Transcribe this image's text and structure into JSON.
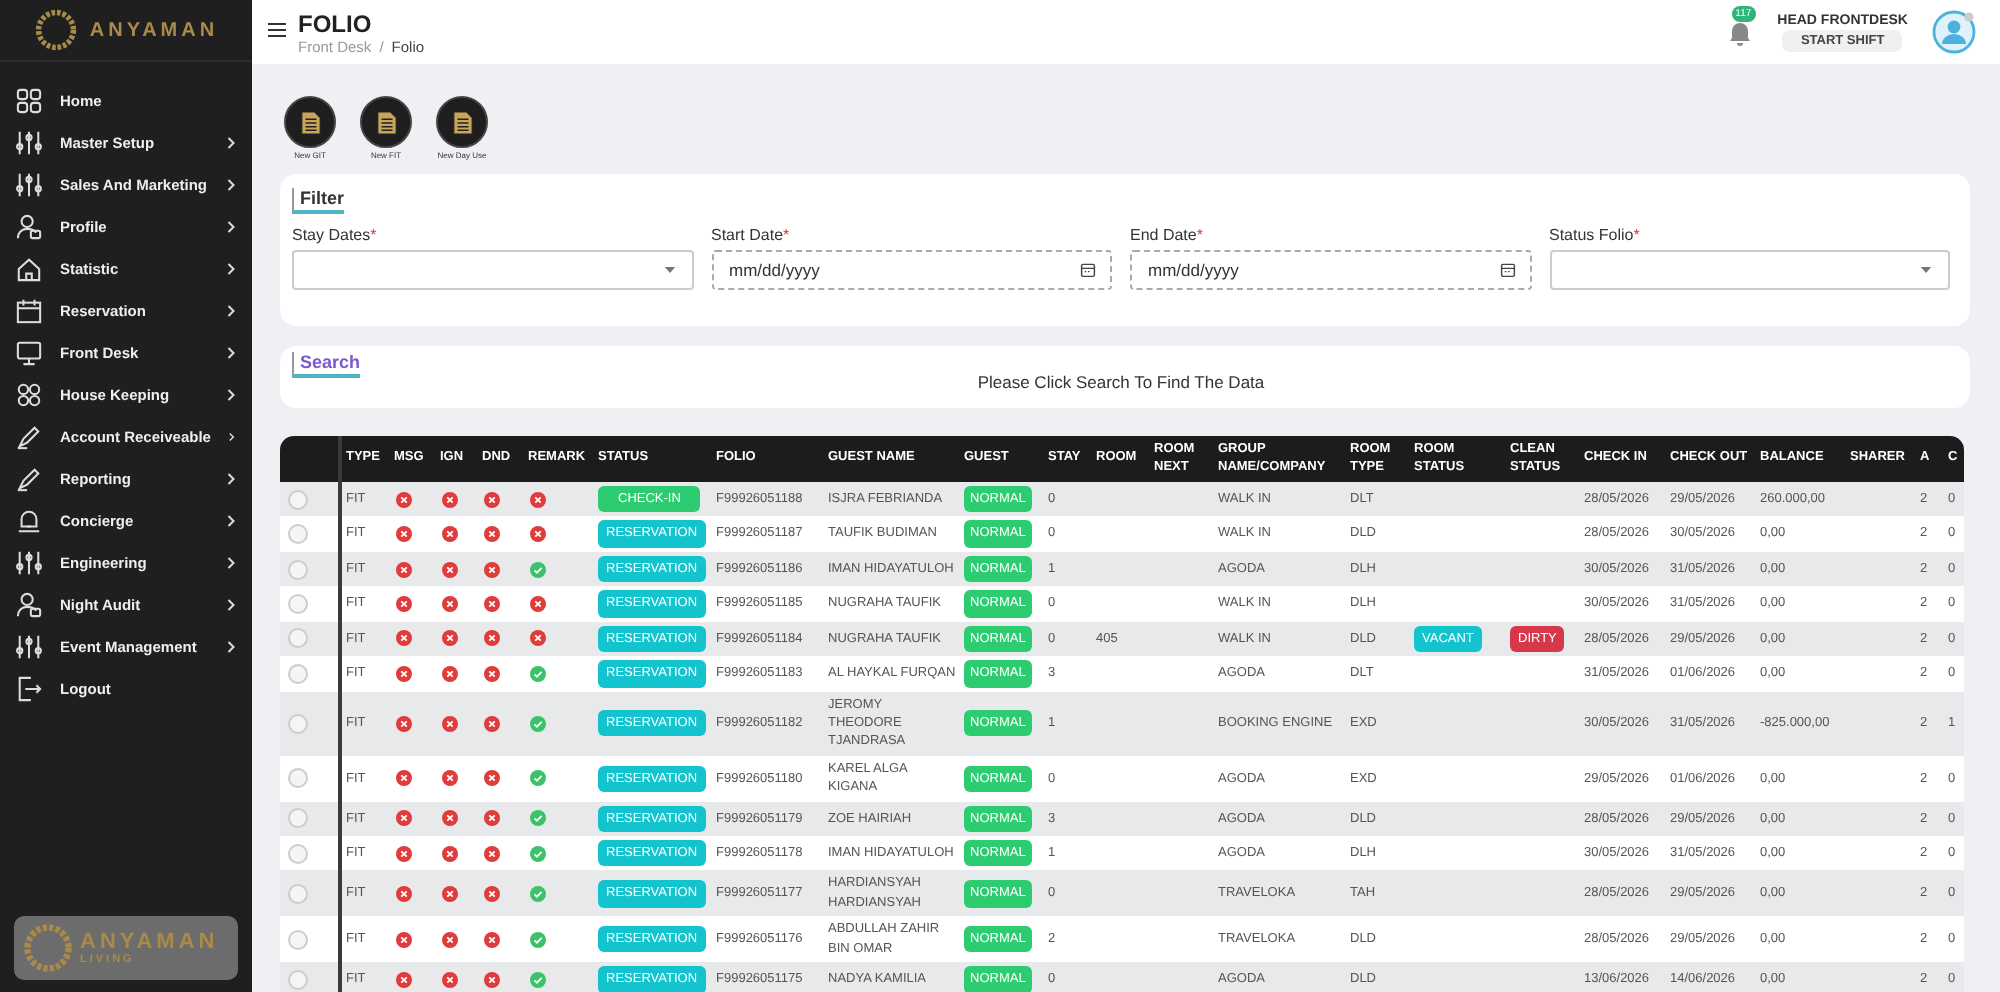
{
  "sidebar": {
    "brand": "ANYAMAN",
    "items": [
      {
        "label": "Home",
        "submenu": false
      },
      {
        "label": "Master Setup",
        "submenu": true
      },
      {
        "label": "Sales And Marketing",
        "submenu": true
      },
      {
        "label": "Profile",
        "submenu": true
      },
      {
        "label": "Statistic",
        "submenu": true
      },
      {
        "label": "Reservation",
        "submenu": true
      },
      {
        "label": "Front Desk",
        "submenu": true
      },
      {
        "label": "House Keeping",
        "submenu": true
      },
      {
        "label": "Account Receiveable",
        "submenu": true
      },
      {
        "label": "Reporting",
        "submenu": true
      },
      {
        "label": "Concierge",
        "submenu": true
      },
      {
        "label": "Engineering",
        "submenu": true
      },
      {
        "label": "Night Audit",
        "submenu": true
      },
      {
        "label": "Event Management",
        "submenu": true
      },
      {
        "label": "Logout",
        "submenu": false
      }
    ],
    "footer_brand": "ANYAMAN",
    "footer_sub": "LIVING"
  },
  "header": {
    "title": "FOLIO",
    "breadcrumb": [
      "Front Desk",
      "Folio"
    ],
    "breadcrumb_sep": "/",
    "notifications": "117",
    "user": "HEAD FRONTDESK",
    "shift_button": "START SHIFT"
  },
  "quick_actions": [
    "New GIT",
    "New FIT",
    "New Day Use"
  ],
  "filter": {
    "title": "Filter",
    "fields": [
      {
        "label": "Stay Dates",
        "required_mark": "*",
        "kind": "select"
      },
      {
        "label": "Start Date",
        "required_mark": "*",
        "kind": "date",
        "placeholder": "mm/dd/yyyy"
      },
      {
        "label": "End Date",
        "required_mark": "*",
        "kind": "date",
        "placeholder": "mm/dd/yyyy"
      },
      {
        "label": "Status Folio",
        "required_mark": "*",
        "kind": "select"
      }
    ]
  },
  "search": {
    "title": "Search",
    "message": "Please Click Search To Find The Data"
  },
  "table": {
    "columns": [
      "TYPE",
      "MSG",
      "IGN",
      "DND",
      "REMARK",
      "STATUS",
      "FOLIO",
      "GUEST NAME",
      "GUEST",
      "STAY",
      "ROOM",
      "ROOM NEXT",
      "GROUP NAME/COMPANY",
      "ROOM TYPE",
      "ROOM STATUS",
      "CLEAN STATUS",
      "CHECK IN",
      "CHECK OUT",
      "BALANCE",
      "SHARER",
      "A",
      "C"
    ],
    "rows": [
      {
        "checked": false,
        "type": "FIT",
        "msg": false,
        "ign": false,
        "dnd": false,
        "remark": false,
        "status": {
          "label": "CHECK-IN",
          "kind": "checkin"
        },
        "folio": "F99926051188",
        "guest_name": "ISJRA FEBRIANDA",
        "guest": "NORMAL",
        "stay": "0",
        "group": "WALK IN",
        "room_type": "DLT",
        "check_in": "28/05/2026",
        "check_out": "29/05/2026",
        "balance": "260.000,00",
        "a": "2",
        "c": "0"
      },
      {
        "checked": false,
        "type": "FIT",
        "msg": false,
        "ign": false,
        "dnd": false,
        "remark": false,
        "status": {
          "label": "RESERVATION",
          "kind": "reservation"
        },
        "folio": "F99926051187",
        "guest_name": "TAUFIK BUDIMAN",
        "guest": "NORMAL",
        "stay": "0",
        "group": "WALK IN",
        "room_type": "DLD",
        "check_in": "28/05/2026",
        "check_out": "30/05/2026",
        "balance": "0,00",
        "a": "2",
        "c": "0"
      },
      {
        "checked": false,
        "type": "FIT",
        "msg": false,
        "ign": false,
        "dnd": false,
        "remark": true,
        "status": {
          "label": "RESERVATION",
          "kind": "reservation"
        },
        "folio": "F99926051186",
        "guest_name": "IMAN HIDAYATULOH",
        "guest": "NORMAL",
        "stay": "1",
        "group": "AGODA",
        "room_type": "DLH",
        "check_in": "30/05/2026",
        "check_out": "31/05/2026",
        "balance": "0,00",
        "a": "2",
        "c": "0"
      },
      {
        "checked": false,
        "type": "FIT",
        "msg": false,
        "ign": false,
        "dnd": false,
        "remark": false,
        "status": {
          "label": "RESERVATION",
          "kind": "reservation"
        },
        "folio": "F99926051185",
        "guest_name": "NUGRAHA TAUFIK",
        "guest": "NORMAL",
        "stay": "0",
        "group": "WALK IN",
        "room_type": "DLH",
        "check_in": "30/05/2026",
        "check_out": "31/05/2026",
        "balance": "0,00",
        "a": "2",
        "c": "0"
      },
      {
        "checked": false,
        "type": "FIT",
        "msg": false,
        "ign": false,
        "dnd": false,
        "remark": false,
        "status": {
          "label": "RESERVATION",
          "kind": "reservation"
        },
        "folio": "F99926051184",
        "guest_name": "NUGRAHA TAUFIK",
        "guest": "NORMAL",
        "stay": "0",
        "room": "405",
        "group": "WALK IN",
        "room_type": "DLD",
        "room_status": "VACANT",
        "clean_status": "DIRTY",
        "check_in": "28/05/2026",
        "check_out": "29/05/2026",
        "balance": "0,00",
        "a": "2",
        "c": "0"
      },
      {
        "checked": false,
        "type": "FIT",
        "msg": false,
        "ign": false,
        "dnd": false,
        "remark": true,
        "status": {
          "label": "RESERVATION",
          "kind": "reservation"
        },
        "folio": "F99926051183",
        "guest_name": "AL HAYKAL FURQAN",
        "guest": "NORMAL",
        "stay": "3",
        "group": "AGODA",
        "room_type": "DLT",
        "check_in": "31/05/2026",
        "check_out": "01/06/2026",
        "balance": "0,00",
        "a": "2",
        "c": "0"
      },
      {
        "checked": false,
        "type": "FIT",
        "msg": false,
        "ign": false,
        "dnd": false,
        "remark": true,
        "status": {
          "label": "RESERVATION",
          "kind": "reservation"
        },
        "folio": "F99926051182",
        "guest_name": "JEROMY THEODORE TJANDRASA",
        "guest": "NORMAL",
        "stay": "1",
        "group": "BOOKING ENGINE",
        "room_type": "EXD",
        "check_in": "30/05/2026",
        "check_out": "31/05/2026",
        "balance": "-825.000,00",
        "a": "2",
        "c": "1"
      },
      {
        "checked": false,
        "type": "FIT",
        "msg": false,
        "ign": false,
        "dnd": false,
        "remark": true,
        "status": {
          "label": "RESERVATION",
          "kind": "reservation"
        },
        "folio": "F99926051180",
        "guest_name": "KAREL ALGA KIGANA",
        "guest": "NORMAL",
        "stay": "0",
        "group": "AGODA",
        "room_type": "EXD",
        "check_in": "29/05/2026",
        "check_out": "01/06/2026",
        "balance": "0,00",
        "a": "2",
        "c": "0"
      },
      {
        "checked": false,
        "type": "FIT",
        "msg": false,
        "ign": false,
        "dnd": false,
        "remark": true,
        "status": {
          "label": "RESERVATION",
          "kind": "reservation"
        },
        "folio": "F99926051179",
        "guest_name": "ZOE HAIRIAH",
        "guest": "NORMAL",
        "stay": "3",
        "group": "AGODA",
        "room_type": "DLD",
        "check_in": "28/05/2026",
        "check_out": "29/05/2026",
        "balance": "0,00",
        "a": "2",
        "c": "0"
      },
      {
        "checked": false,
        "type": "FIT",
        "msg": false,
        "ign": false,
        "dnd": false,
        "remark": true,
        "status": {
          "label": "RESERVATION",
          "kind": "reservation"
        },
        "folio": "F99926051178",
        "guest_name": "IMAN HIDAYATULOH",
        "guest": "NORMAL",
        "stay": "1",
        "group": "AGODA",
        "room_type": "DLH",
        "check_in": "30/05/2026",
        "check_out": "31/05/2026",
        "balance": "0,00",
        "a": "2",
        "c": "0"
      },
      {
        "checked": false,
        "type": "FIT",
        "msg": false,
        "ign": false,
        "dnd": false,
        "remark": true,
        "status": {
          "label": "RESERVATION",
          "kind": "reservation"
        },
        "folio": "F99926051177",
        "guest_name": "HARDIANSYAH HARDIANSYAH",
        "guest": "NORMAL",
        "stay": "0",
        "group": "TRAVELOKA",
        "room_type": "TAH",
        "check_in": "28/05/2026",
        "check_out": "29/05/2026",
        "balance": "0,00",
        "a": "2",
        "c": "0"
      },
      {
        "checked": false,
        "type": "FIT",
        "msg": false,
        "ign": false,
        "dnd": false,
        "remark": true,
        "status": {
          "label": "RESERVATION",
          "kind": "reservation"
        },
        "folio": "F99926051176",
        "guest_name": "ABDULLAH ZAHIR BIN OMAR",
        "guest": "NORMAL",
        "stay": "2",
        "group": "TRAVELOKA",
        "room_type": "DLD",
        "check_in": "28/05/2026",
        "check_out": "29/05/2026",
        "balance": "0,00",
        "a": "2",
        "c": "0"
      },
      {
        "checked": false,
        "type": "FIT",
        "msg": false,
        "ign": false,
        "dnd": false,
        "remark": true,
        "status": {
          "label": "RESERVATION",
          "kind": "reservation"
        },
        "folio": "F99926051175",
        "guest_name": "NADYA KAMILIA",
        "guest": "NORMAL",
        "stay": "0",
        "group": "AGODA",
        "room_type": "DLD",
        "check_in": "13/06/2026",
        "check_out": "14/06/2026",
        "balance": "0,00",
        "a": "2",
        "c": "0"
      }
    ]
  }
}
